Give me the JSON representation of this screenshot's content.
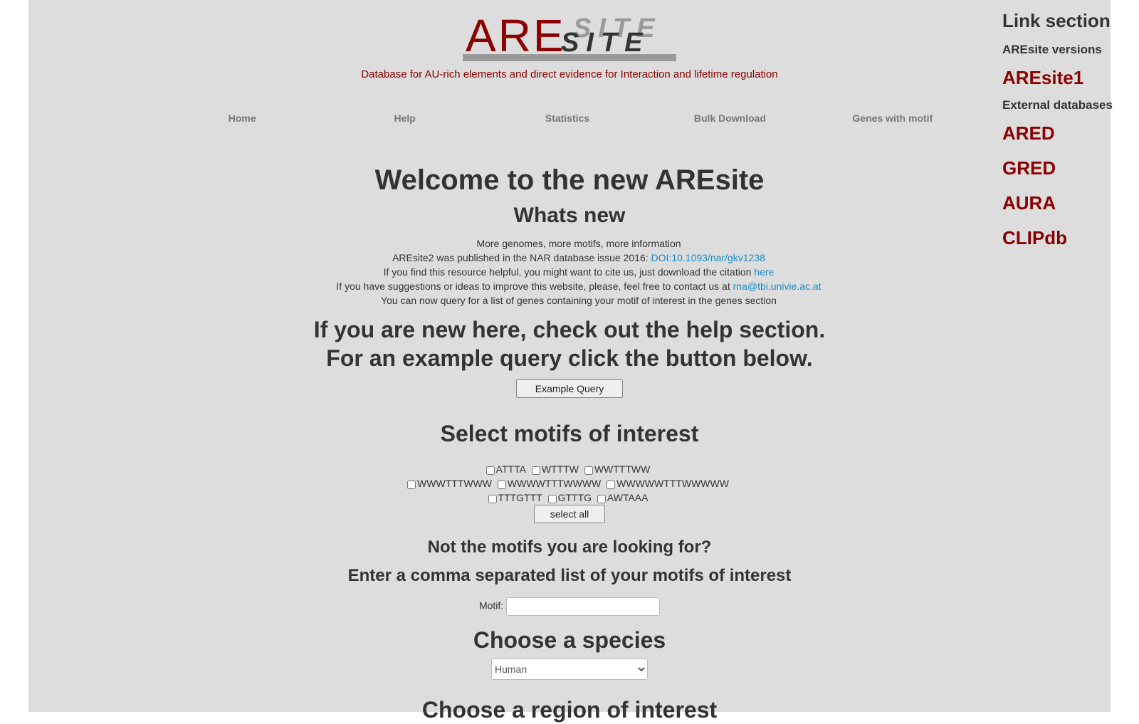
{
  "header": {
    "logo_are": "ARE",
    "logo_site": "SITE",
    "tagline": "Database for AU-rich elements and direct evidence for Interaction and lifetime regulation"
  },
  "nav": {
    "items": [
      "Home",
      "Help",
      "Statistics",
      "Bulk Download",
      "Genes with motif"
    ]
  },
  "main": {
    "welcome": "Welcome to the new AREsite",
    "whats_new": "Whats new",
    "news": {
      "line1": "More genomes, more motifs, more information",
      "line2_text": "AREsite2 was published in the NAR database issue 2016: ",
      "line2_link": "DOI:10.1093/nar/gkv1238",
      "line3_text": "If you find this resource helpful, you might want to cite us, just download the citation ",
      "line3_link": "here",
      "line4_text": "If you have suggestions or ideas to improve this website, please, feel free to contact us at ",
      "line4_link": "rna@tbi.univie.ac.at",
      "line5": "You can now query for a list of genes containing your motif of interest in the genes section"
    },
    "help_intro_1": "If you are new here, check out the help section.",
    "help_intro_2": "For an example query click the button below.",
    "example_button": "Example Query",
    "select_motifs_title": "Select motifs of interest",
    "motifs_row1": [
      "ATTTA",
      "WTTTW",
      "WWTTTWW"
    ],
    "motifs_row2": [
      "WWWTTTWWW",
      "WWWWTTTWWWW",
      "WWWWWTTTWWWWW"
    ],
    "motifs_row3": [
      "TTTGTTT",
      "GTTTG",
      "AWTAAA"
    ],
    "select_all_button": "select all",
    "not_looking": "Not the motifs you are looking for?",
    "enter_list": "Enter a comma separated list of your motifs of interest",
    "motif_label": "Motif:",
    "motif_value": "",
    "choose_species": "Choose a species",
    "species_selected": "Human",
    "choose_region": "Choose a region of interest"
  },
  "sidebar": {
    "title": "Link section",
    "versions_label": "AREsite versions",
    "version_links": [
      "AREsite1"
    ],
    "external_label": "External databases",
    "external_links": [
      "ARED",
      "GRED",
      "AURA",
      "CLIPdb"
    ]
  },
  "colors": {
    "brand_red": "#8b0000",
    "link_blue": "#1a8bc8",
    "page_bg": "#dddddd"
  }
}
